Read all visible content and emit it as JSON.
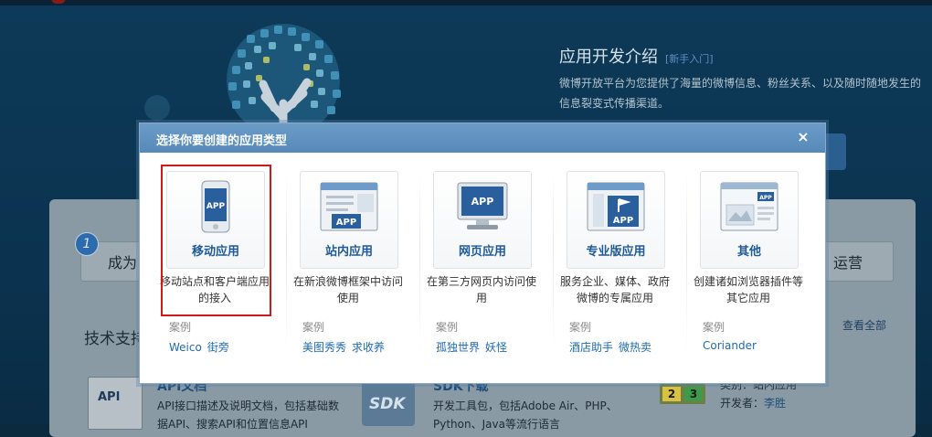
{
  "background": {
    "intro": {
      "title": "应用开发介绍",
      "link": "[新手入门]",
      "desc": "微博开放平台为您提供了海量的微博信息、粉丝关系、以及随时随地发生的信息裂变式传播渠道。"
    },
    "steps": {
      "step_number": "1",
      "step_text": "成为",
      "right_text": "运营"
    },
    "tech": {
      "title": "技术支持",
      "view_all": "查看全部"
    },
    "api": {
      "icon_text": "API",
      "title": "API文档",
      "desc": "API接口描述及说明文档，包括基础数据API、搜索API和位置信息API"
    },
    "sdk": {
      "icon_text": "SDK",
      "title": "SDK下载",
      "desc": "开发工具包，包括Adobe Air、PHP、Python、Java等流行语言"
    },
    "app_info": {
      "badge_a": "2",
      "badge_b": "3",
      "category": "类别：站内应用",
      "developer_label": "开发者：",
      "developer": "李胜"
    }
  },
  "modal": {
    "title": "选择你要创建的应用类型",
    "close": "×",
    "case_label": "案例",
    "cards": [
      {
        "id": "mobile",
        "label": "移动应用",
        "desc": "移动站点和客户端应用的接入",
        "cases": [
          "Weico",
          "街旁"
        ],
        "icon_text": "APP"
      },
      {
        "id": "site",
        "label": "站内应用",
        "desc": "在新浪微博框架中访问使用",
        "cases": [
          "美图秀秀",
          "求收养"
        ],
        "icon_text": "APP"
      },
      {
        "id": "web",
        "label": "网页应用",
        "desc": "在第三方网页内访问使用",
        "cases": [
          "孤独世界",
          "妖怪"
        ],
        "icon_text": "APP"
      },
      {
        "id": "pro",
        "label": "专业版应用",
        "desc": "服务企业、媒体、政府微博的专属应用",
        "cases": [
          "酒店助手",
          "微热卖"
        ],
        "icon_text": "APP"
      },
      {
        "id": "other",
        "label": "其他",
        "desc": "创建诸如浏览器插件等其它应用",
        "cases": [
          "Coriander"
        ],
        "icon_text": "APP"
      }
    ],
    "selected_index": 0
  },
  "colors": {
    "accent": "#5589b8",
    "link": "#1f6ab0",
    "selected_border": "#d0191b"
  }
}
